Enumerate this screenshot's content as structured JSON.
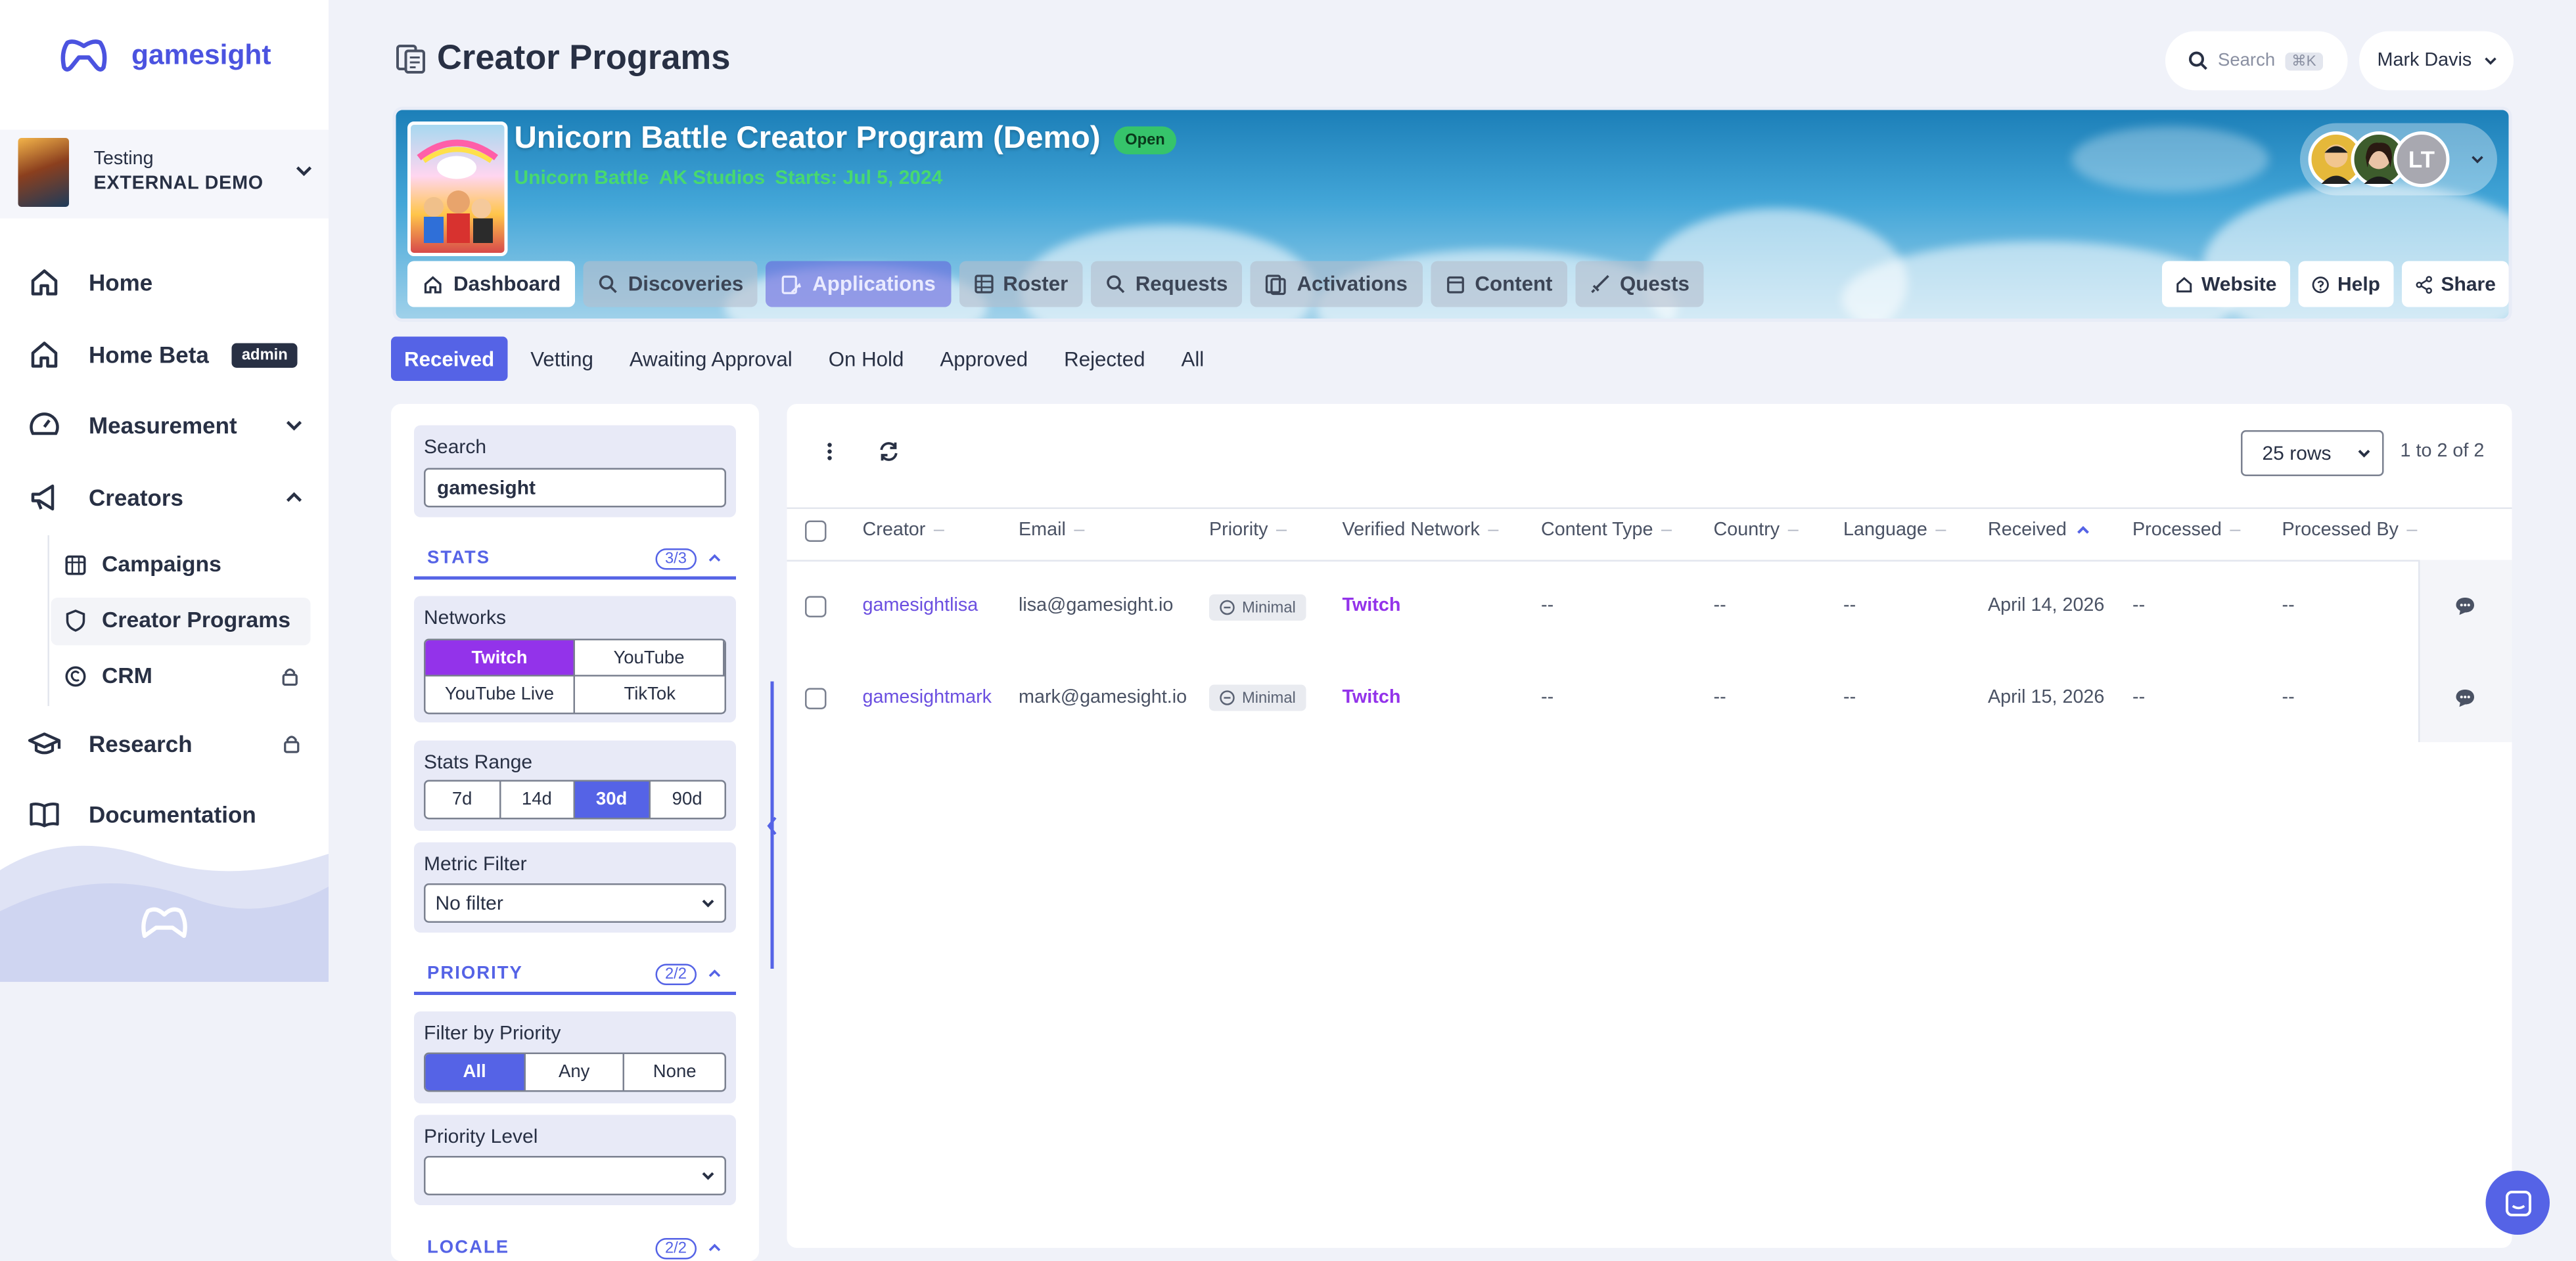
{
  "app": {
    "brand": "gamesight"
  },
  "org": {
    "line1": "Testing",
    "line2": "EXTERNAL DEMO"
  },
  "nav": {
    "home": "Home",
    "home_beta": "Home Beta",
    "admin_badge": "admin",
    "measurement": "Measurement",
    "creators": "Creators",
    "campaigns": "Campaigns",
    "creator_programs": "Creator Programs",
    "crm": "CRM",
    "research": "Research",
    "documentation": "Documentation"
  },
  "header": {
    "title": "Creator Programs",
    "search_label": "Search",
    "search_shortcut": "⌘K",
    "user_name": "Mark Davis"
  },
  "program": {
    "title": "Unicorn Battle Creator Program (Demo)",
    "status": "Open",
    "game": "Unicorn Battle",
    "studio": "AK Studios",
    "starts": "Starts: Jul 5, 2024",
    "avatar_initials": "LT",
    "tabs": [
      "Dashboard",
      "Discoveries",
      "Applications",
      "Roster",
      "Requests",
      "Activations",
      "Content",
      "Quests"
    ],
    "links": {
      "website": "Website",
      "help": "Help",
      "share": "Share"
    }
  },
  "status_tabs": [
    "Received",
    "Vetting",
    "Awaiting Approval",
    "On Hold",
    "Approved",
    "Rejected",
    "All"
  ],
  "filters": {
    "search_label": "Search",
    "search_value": "gamesight",
    "stats": {
      "title": "STATS",
      "count": "3/3"
    },
    "networks_label": "Networks",
    "networks": [
      "Twitch",
      "YouTube",
      "YouTube Live",
      "TikTok"
    ],
    "stats_range_label": "Stats Range",
    "stats_range": [
      "7d",
      "14d",
      "30d",
      "90d"
    ],
    "metric_filter_label": "Metric Filter",
    "metric_filter_value": "No filter",
    "priority": {
      "title": "PRIORITY",
      "count": "2/2"
    },
    "filter_by_priority_label": "Filter by Priority",
    "priority_options": [
      "All",
      "Any",
      "None"
    ],
    "priority_level_label": "Priority Level",
    "priority_level_value": "",
    "locale": {
      "title": "LOCALE",
      "count": "2/2"
    }
  },
  "table": {
    "rows_select": "25 rows",
    "pager": "1 to 2 of 2",
    "columns": [
      "Creator",
      "Email",
      "Priority",
      "Verified Network",
      "Content Type",
      "Country",
      "Language",
      "Received",
      "Processed",
      "Processed By"
    ],
    "rows": [
      {
        "creator": "gamesightlisa",
        "email": "lisa@gamesight.io",
        "priority": "Minimal",
        "network": "Twitch",
        "content_type": "--",
        "country": "--",
        "language": "--",
        "received": "April 14, 2026",
        "processed": "--",
        "processed_by": "--"
      },
      {
        "creator": "gamesightmark",
        "email": "mark@gamesight.io",
        "priority": "Minimal",
        "network": "Twitch",
        "content_type": "--",
        "country": "--",
        "language": "--",
        "received": "April 15, 2026",
        "processed": "--",
        "processed_by": "--"
      }
    ]
  },
  "colors": {
    "accent": "#5563e6",
    "twitch": "#9333ea",
    "open_badge": "#36c46b",
    "banner_subtitle": "#48d96f"
  }
}
